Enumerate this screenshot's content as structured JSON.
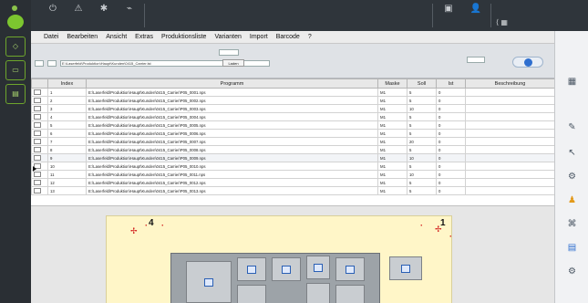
{
  "menu": [
    "Datei",
    "Bearbeiten",
    "Ansicht",
    "Extras",
    "Produktionsliste",
    "Varianten",
    "Import",
    "Barcode",
    "?"
  ],
  "colors": {
    "accent_green": "#7cc62f",
    "rail_bg": "#2a2f34",
    "topbar_bg": "#2f353b",
    "paper": "#fff6c8",
    "marker_red": "#d01414",
    "toggle_blue": "#2f6fcf"
  },
  "filter": {
    "path_value": "E:\\Laserfeld\\Produktion\\Haupt\\Kunden\\0415_Carrier.lst",
    "button_label": "Laden"
  },
  "table": {
    "headers": [
      "Index",
      "Programm",
      "Maske",
      "Soll",
      "Ist",
      "Beschreibung"
    ],
    "rows": [
      {
        "index": "1",
        "program": "E:\\Laserfeld\\Produktion\\Haupt\\Kunden\\0415_Carrier\\P05_0001.nps",
        "maske": "M1",
        "soll": "5",
        "ist": "0"
      },
      {
        "index": "2",
        "program": "E:\\Laserfeld\\Produktion\\Haupt\\Kunden\\0415_Carrier\\P05_0002.nps",
        "maske": "M1",
        "soll": "5",
        "ist": "0"
      },
      {
        "index": "3",
        "program": "E:\\Laserfeld\\Produktion\\Haupt\\Kunden\\0415_Carrier\\P05_0003.nps",
        "maske": "M1",
        "soll": "10",
        "ist": "0"
      },
      {
        "index": "4",
        "program": "E:\\Laserfeld\\Produktion\\Haupt\\Kunden\\0415_Carrier\\P05_0004.nps",
        "maske": "M1",
        "soll": "5",
        "ist": "0"
      },
      {
        "index": "5",
        "program": "E:\\Laserfeld\\Produktion\\Haupt\\Kunden\\0415_Carrier\\P05_0005.nps",
        "maske": "M1",
        "soll": "5",
        "ist": "0"
      },
      {
        "index": "6",
        "program": "E:\\Laserfeld\\Produktion\\Haupt\\Kunden\\0415_Carrier\\P05_0006.nps",
        "maske": "M1",
        "soll": "5",
        "ist": "0"
      },
      {
        "index": "7",
        "program": "E:\\Laserfeld\\Produktion\\Haupt\\Kunden\\0415_Carrier\\P05_0007.nps",
        "maske": "M1",
        "soll": "20",
        "ist": "0"
      },
      {
        "index": "8",
        "program": "E:\\Laserfeld\\Produktion\\Haupt\\Kunden\\0415_Carrier\\P05_0008.nps",
        "maske": "M1",
        "soll": "5",
        "ist": "0"
      },
      {
        "index": "9",
        "program": "E:\\Laserfeld\\Produktion\\Haupt\\Kunden\\0415_Carrier\\P05_0009.nps",
        "maske": "M1",
        "soll": "10",
        "ist": "0"
      },
      {
        "index": "10",
        "program": "E:\\Laserfeld\\Produktion\\Haupt\\Kunden\\0415_Carrier\\P05_0010.nps",
        "maske": "M1",
        "soll": "5",
        "ist": "0"
      },
      {
        "index": "11",
        "program": "E:\\Laserfeld\\Produktion\\Haupt\\Kunden\\0415_Carrier\\P05_0011.nps",
        "maske": "M1",
        "soll": "10",
        "ist": "0"
      },
      {
        "index": "12",
        "program": "E:\\Laserfeld\\Produktion\\Haupt\\Kunden\\0415_Carrier\\P05_0012.nps",
        "maske": "M1",
        "soll": "5",
        "ist": "0"
      },
      {
        "index": "13",
        "program": "E:\\Laserfeld\\Produktion\\Haupt\\Kunden\\0415_Carrier\\P05_0013.nps",
        "maske": "M1",
        "soll": "5",
        "ist": "0"
      }
    ]
  },
  "preview": {
    "marker_left": "4",
    "marker_right": "1"
  }
}
